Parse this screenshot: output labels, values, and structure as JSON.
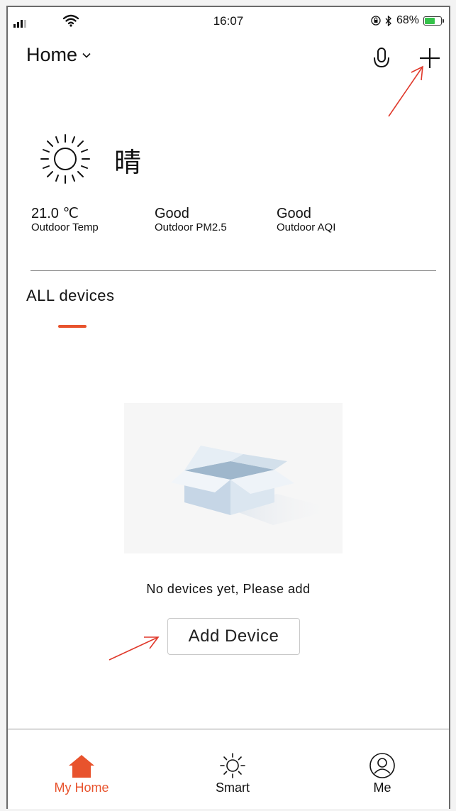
{
  "status_bar": {
    "time": "16:07",
    "battery": "68%",
    "battery_level": 0.68,
    "battery_color": "#35c24a"
  },
  "header": {
    "home_label": "Home"
  },
  "weather": {
    "icon": "sun-icon",
    "condition": "晴",
    "stats": [
      {
        "value": "21.0 ℃",
        "label": "Outdoor Temp"
      },
      {
        "value": "Good",
        "label": "Outdoor PM2.5"
      },
      {
        "value": "Good",
        "label": "Outdoor AQI"
      }
    ]
  },
  "devices": {
    "section_title": "ALL devices",
    "empty_text": "No devices yet, Please add",
    "add_button": "Add Device"
  },
  "tabs": [
    {
      "label": "My Home",
      "icon": "home-icon",
      "active": true
    },
    {
      "label": "Smart",
      "icon": "sun-icon",
      "active": false
    },
    {
      "label": "Me",
      "icon": "user-icon",
      "active": false
    }
  ],
  "colors": {
    "accent": "#e8532d",
    "annotation": "#e0392b"
  }
}
